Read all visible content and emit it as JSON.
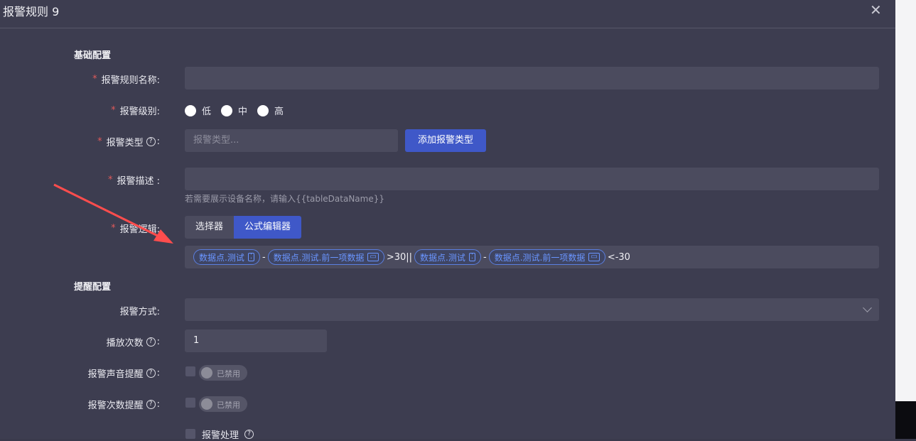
{
  "dialog": {
    "title": "报警规则 9",
    "close_icon": "close-icon"
  },
  "basic": {
    "section_title": "基础配置",
    "rule_name": {
      "label": "报警规则名称:",
      "value": ""
    },
    "level": {
      "label": "报警级别:",
      "options": [
        "低",
        "中",
        "高"
      ]
    },
    "type": {
      "label": "报警类型",
      "placeholder": "报警类型...",
      "add_button": "添加报警类型"
    },
    "description": {
      "label": "报警描述 :",
      "value": "",
      "hint": "若需要展示设备名称，请输入{{tableDataName}}"
    },
    "logic": {
      "label": "报警逻辑:",
      "tabs": [
        "选择器",
        "公式编辑器"
      ],
      "active_tab": "公式编辑器",
      "formula": {
        "tag1": "数据点.测试",
        "op1": "-",
        "tag2": "数据点.测试.前一项数据",
        "op2": ">30||",
        "tag3": "数据点.测试",
        "op3": "-",
        "tag4": "数据点.测试.前一项数据",
        "op4": "<-30"
      }
    }
  },
  "reminder": {
    "section_title": "提醒配置",
    "method": {
      "label": "报警方式:",
      "value": ""
    },
    "play_count": {
      "label": "播放次数",
      "value": "1"
    },
    "sound": {
      "label": "报警声音提醒",
      "switch_text": "已禁用"
    },
    "count_reminder": {
      "label": "报警次数提醒",
      "switch_text": "已禁用"
    },
    "handling": {
      "label": "报警处理"
    }
  },
  "colors": {
    "primary": "#3f58c8",
    "background": "#3d3d50",
    "input": "#4b4b5e",
    "required": "#e05a5a",
    "tag": "#6a95ff",
    "annotation_arrow": "#ff4d4d"
  }
}
